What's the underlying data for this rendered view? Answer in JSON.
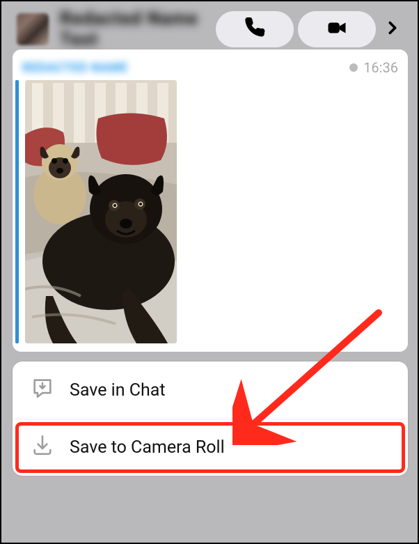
{
  "header": {
    "contact_name": "Redacted Name Text",
    "icons": {
      "call": "phone-icon",
      "video": "video-icon",
      "more": "chevron-right-icon"
    }
  },
  "chat": {
    "sender_label": "REDACTED NAME",
    "timestamp": "16:36",
    "image_alt": "Two pugs on a bed"
  },
  "sheet": {
    "save_in_chat_label": "Save in Chat",
    "save_to_camera_roll_label": "Save to Camera Roll"
  },
  "annotation": {
    "highlight": "save-to-camera-roll",
    "arrow_color": "#ff2a1c"
  }
}
